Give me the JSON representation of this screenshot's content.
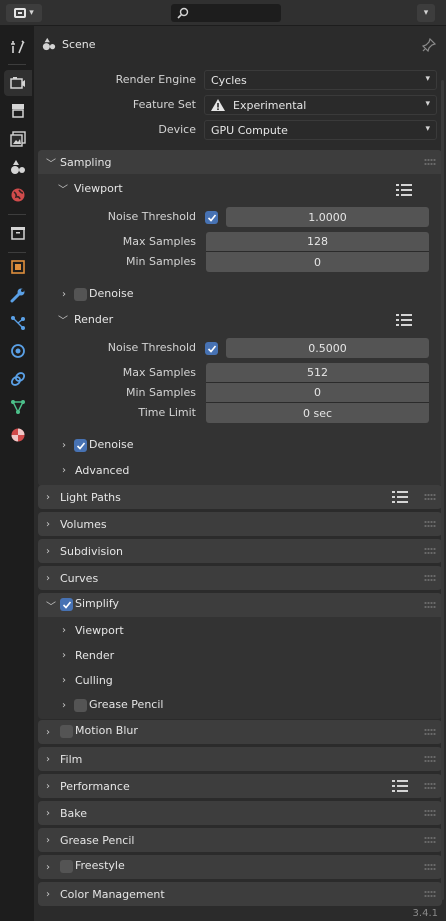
{
  "header": {
    "editor_icon": "properties-editor-icon",
    "search_icon": "search-icon",
    "dropdown_icon": "chevron-down-icon"
  },
  "tabs": [
    {
      "name": "tool-icon"
    },
    {
      "name": "render-icon",
      "active": true
    },
    {
      "name": "output-icon"
    },
    {
      "name": "view-layer-icon"
    },
    {
      "name": "scene-icon"
    },
    {
      "name": "world-icon"
    },
    {
      "name": "collection-icon"
    },
    {
      "name": "object-icon"
    },
    {
      "name": "modifier-wrench-icon"
    },
    {
      "name": "particles-icon"
    },
    {
      "name": "physics-icon"
    },
    {
      "name": "constraints-icon"
    },
    {
      "name": "object-data-icon"
    },
    {
      "name": "material-icon"
    }
  ],
  "context": {
    "label": "Scene"
  },
  "render_engine": {
    "label": "Render Engine",
    "value": "Cycles"
  },
  "feature_set": {
    "label": "Feature Set",
    "value": "Experimental"
  },
  "device": {
    "label": "Device",
    "value": "GPU Compute"
  },
  "sampling": {
    "title": "Sampling",
    "viewport": {
      "title": "Viewport",
      "noise_threshold_label": "Noise Threshold",
      "noise_threshold": "1.0000",
      "max_samples_label": "Max Samples",
      "max_samples": "128",
      "min_samples_label": "Min Samples",
      "min_samples": "0",
      "denoise_label": "Denoise"
    },
    "render": {
      "title": "Render",
      "noise_threshold_label": "Noise Threshold",
      "noise_threshold": "0.5000",
      "max_samples_label": "Max Samples",
      "max_samples": "512",
      "min_samples_label": "Min Samples",
      "min_samples": "0",
      "time_limit_label": "Time Limit",
      "time_limit": "0 sec",
      "denoise_label": "Denoise"
    },
    "advanced": "Advanced"
  },
  "panels": {
    "light_paths": "Light Paths",
    "volumes": "Volumes",
    "subdivision": "Subdivision",
    "curves": "Curves",
    "simplify": "Simplify",
    "simplify_viewport": "Viewport",
    "simplify_render": "Render",
    "simplify_culling": "Culling",
    "simplify_grease_pencil": "Grease Pencil",
    "motion_blur": "Motion Blur",
    "film": "Film",
    "performance": "Performance",
    "bake": "Bake",
    "grease_pencil": "Grease Pencil",
    "freestyle": "Freestyle",
    "color_management": "Color Management"
  },
  "version": "3.4.1",
  "colors": {
    "accent": "#4772b3",
    "panel": "#3d3d3d",
    "background": "#2b2b2b"
  }
}
